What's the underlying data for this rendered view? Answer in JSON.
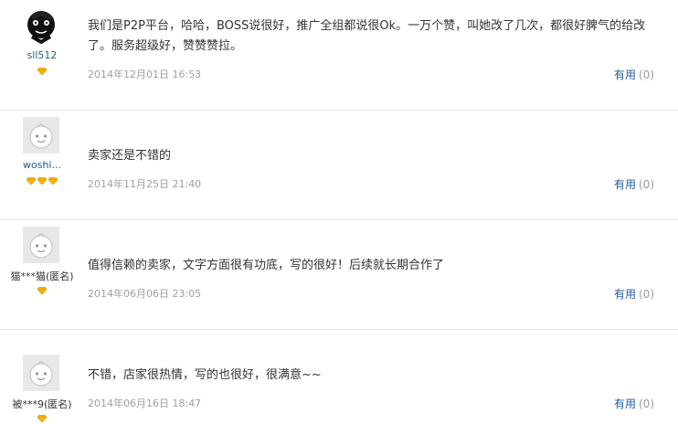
{
  "reviews": [
    {
      "username": "sll512",
      "avatar": "user-photo",
      "badge_count": 1,
      "content": "我们是P2P平台，哈哈，BOSS说很好，推广全组都说很Ok。一万个赞，叫她改了几次，都很好脾气的给改了。服务超级好，赞赞赞拉。",
      "date": "2014年12月01日 16:53",
      "useful_label": "有用",
      "useful_count": "(0)"
    },
    {
      "username": "woshi...",
      "avatar": "default-avatar",
      "badge_count": 3,
      "content": "卖家还是不错的",
      "date": "2014年11月25日 21:40",
      "useful_label": "有用",
      "useful_count": "(0)"
    },
    {
      "username": "猫***猫(匿名)",
      "avatar": "default-avatar",
      "badge_count": 1,
      "content": "值得信赖的卖家，文字方面很有功底，写的很好！后续就长期合作了",
      "date": "2014年06月06日 23:05",
      "useful_label": "有用",
      "useful_count": "(0)"
    },
    {
      "username": "被***9(匿名)",
      "avatar": "default-avatar",
      "badge_count": 1,
      "content": "不错，店家很热情，写的也很好，很满意~~",
      "date": "2014年06月16日 18:47",
      "useful_label": "有用",
      "useful_count": "(0)"
    }
  ],
  "colors": {
    "link": "#1e5a9a",
    "date": "#a0a0a0",
    "badge": "#f5b400",
    "divider": "#e4e4e4"
  }
}
